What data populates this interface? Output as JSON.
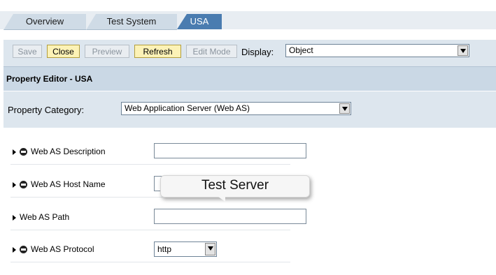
{
  "tabs": [
    {
      "label": "Overview",
      "active": false
    },
    {
      "label": "Test System",
      "active": false
    },
    {
      "label": "USA",
      "active": true
    }
  ],
  "toolbar": {
    "save_label": "Save",
    "close_label": "Close",
    "preview_label": "Preview",
    "refresh_label": "Refresh",
    "edit_mode_label": "Edit Mode",
    "display_label": "Display:",
    "display_value": "Object"
  },
  "editor": {
    "title": "Property Editor - USA",
    "category_label": "Property Category:",
    "category_value": "Web Application Server (Web AS)"
  },
  "properties": [
    {
      "label": "Web AS Description",
      "value": "",
      "icon": "globe-icon"
    },
    {
      "label": "Web AS Host Name",
      "value": "",
      "icon": "globe-icon"
    },
    {
      "label": "Web AS Path",
      "value": ""
    },
    {
      "label": "Web AS Protocol",
      "value": "http",
      "icon": "globe-icon"
    }
  ],
  "tooltip": {
    "text": "Test Server"
  },
  "colors": {
    "tab_active": "#4a7cb0",
    "button_enabled": "#fcf2b6",
    "header_bg": "#cad8e5"
  }
}
